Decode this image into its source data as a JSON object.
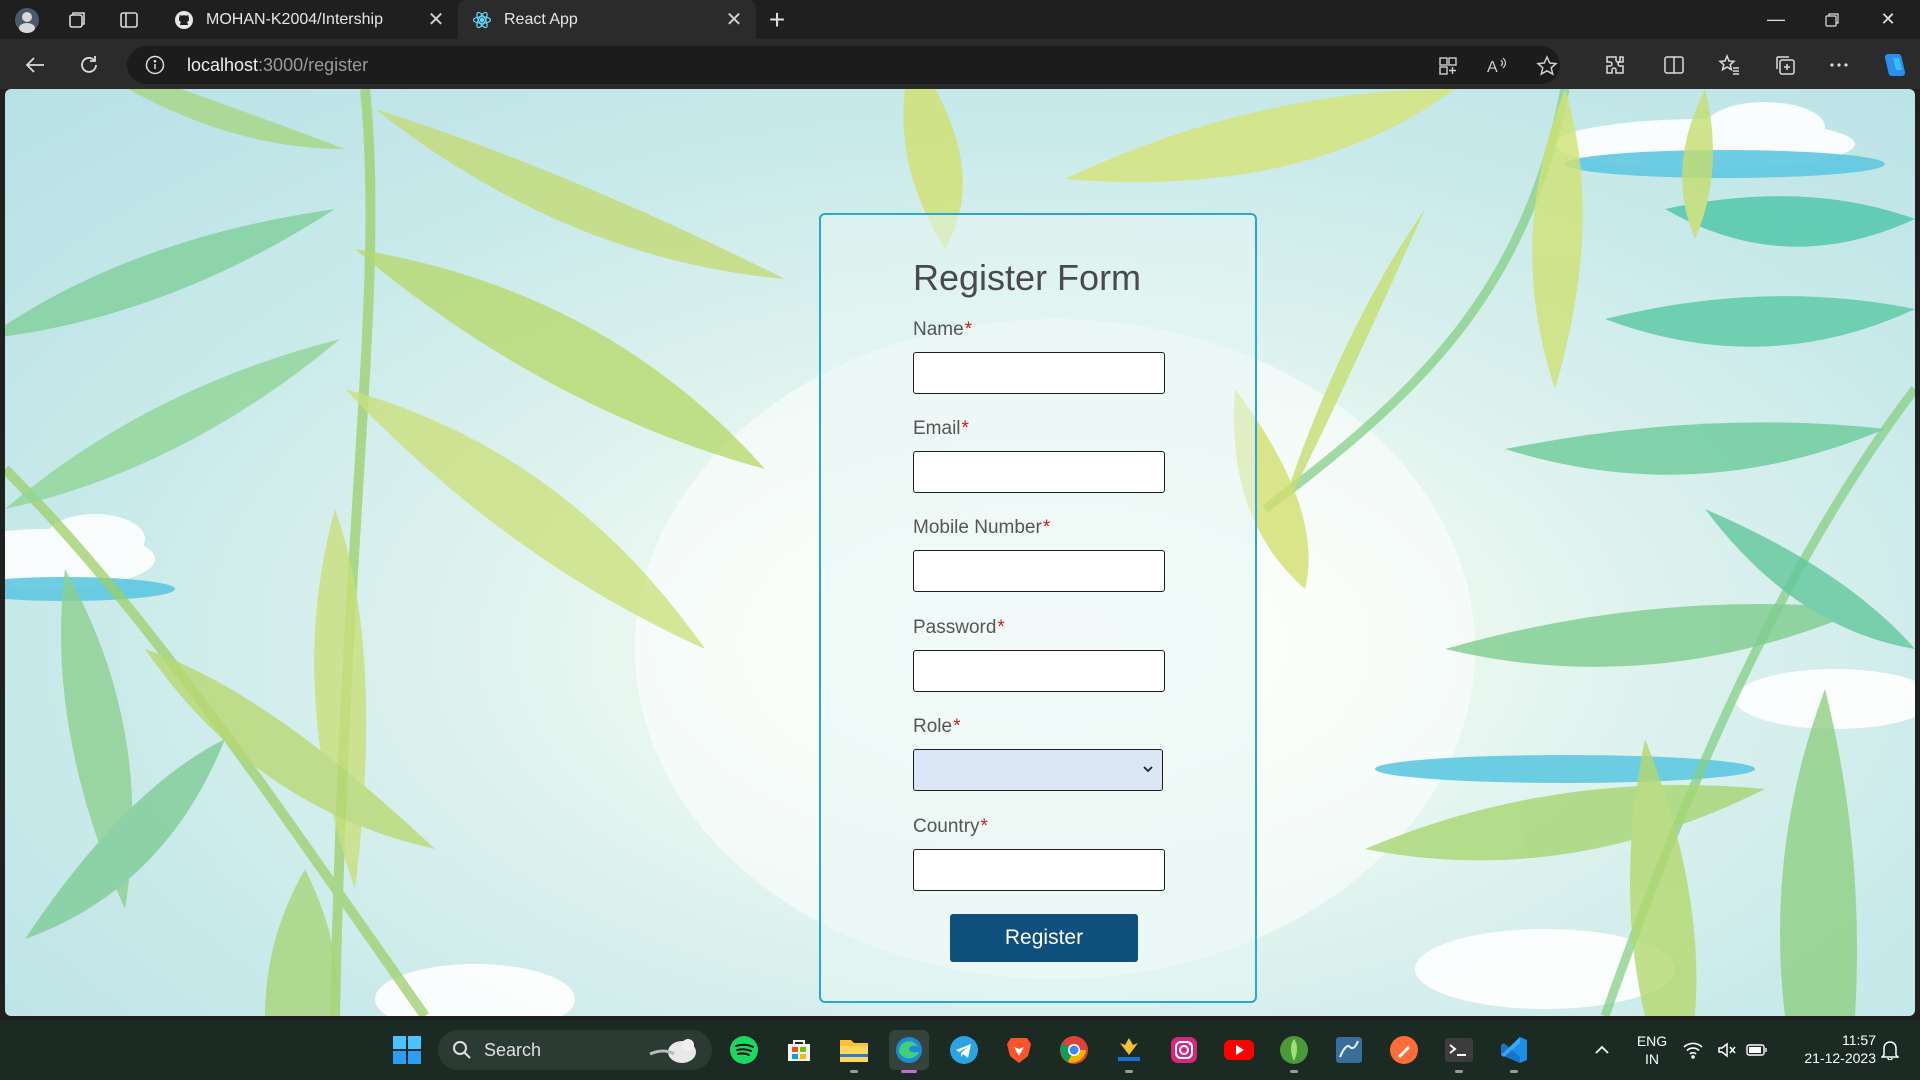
{
  "browser": {
    "tabs": [
      {
        "title": "MOHAN-K2004/Intership",
        "icon": "github-icon",
        "active": false
      },
      {
        "title": "React App",
        "icon": "react-icon",
        "active": true
      }
    ],
    "address": {
      "host": "localhost",
      "path": ":3000/register"
    }
  },
  "form": {
    "title": "Register Form",
    "required_mark": "*",
    "fields": [
      {
        "label": "Name",
        "type": "text",
        "value": ""
      },
      {
        "label": "Email",
        "type": "text",
        "value": ""
      },
      {
        "label": "Mobile Number",
        "type": "text",
        "value": ""
      },
      {
        "label": "Password",
        "type": "password",
        "value": ""
      },
      {
        "label": "Role",
        "type": "select",
        "value": ""
      },
      {
        "label": "Country",
        "type": "text",
        "value": ""
      }
    ],
    "submit_label": "Register"
  },
  "taskbar": {
    "search_label": "Search",
    "apps": [
      "start-icon",
      "spotify-icon",
      "store-icon",
      "file-explorer-icon",
      "edge-icon",
      "telegram-icon",
      "brave-icon",
      "chrome-icon",
      "app-icon",
      "instagram-icon",
      "youtube-icon",
      "mongodb-compass-icon",
      "mysql-workbench-icon",
      "postman-icon",
      "terminal-icon",
      "vscode-icon"
    ],
    "language": {
      "line1": "ENG",
      "line2": "IN"
    },
    "time": "11:57",
    "date": "21-12-2023"
  },
  "colors": {
    "accent": "#0f4f7e",
    "form_border": "#2aa6d0",
    "required": "#d21c1c"
  }
}
